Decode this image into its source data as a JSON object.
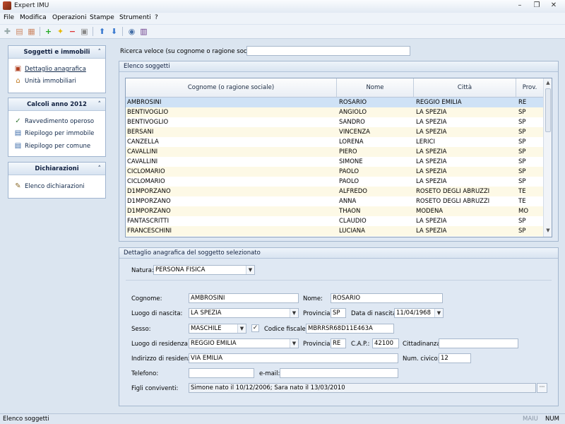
{
  "window": {
    "title": "Expert IMU"
  },
  "menu": [
    "File",
    "Modifica",
    "Operazioni",
    "Stampe",
    "Strumenti",
    "?"
  ],
  "sidebar": {
    "sections": [
      {
        "title": "Soggetti e immobili",
        "items": [
          {
            "label": "Dettaglio anagrafica",
            "icon": "person-card-icon"
          },
          {
            "label": "Unità immobiliari",
            "icon": "house-icon"
          }
        ]
      },
      {
        "title": "Calcoli anno 2012",
        "items": [
          {
            "label": "Ravvedimento operoso",
            "icon": "check-circle-icon"
          },
          {
            "label": "Riepilogo per immobile",
            "icon": "table-icon"
          },
          {
            "label": "Riepilogo per comune",
            "icon": "table-icon"
          }
        ]
      },
      {
        "title": "Dichiarazioni",
        "items": [
          {
            "label": "Elenco dichiarazioni",
            "icon": "pen-icon"
          }
        ]
      }
    ]
  },
  "search": {
    "label": "Ricerca veloce (su cognome o ragione sociale):",
    "value": ""
  },
  "list": {
    "title": "Elenco soggetti",
    "columns": [
      "Cognome (o ragione sociale)",
      "Nome",
      "Città",
      "Prov."
    ],
    "rows": [
      [
        "AMBROSINI",
        "ROSARIO",
        "REGGIO EMILIA",
        "RE"
      ],
      [
        "BENTIVOGLIO",
        "ANGIOLO",
        "LA SPEZIA",
        "SP"
      ],
      [
        "BENTIVOGLIO",
        "SANDRO",
        "LA SPEZIA",
        "SP"
      ],
      [
        "BERSANI",
        "VINCENZA",
        "LA SPEZIA",
        "SP"
      ],
      [
        "CANZELLA",
        "LORENA",
        "LERICI",
        "SP"
      ],
      [
        "CAVALLINI",
        "PIERO",
        "LA SPEZIA",
        "SP"
      ],
      [
        "CAVALLINI",
        "SIMONE",
        "LA SPEZIA",
        "SP"
      ],
      [
        "CICLOMARIO",
        "PAOLO",
        "LA SPEZIA",
        "SP"
      ],
      [
        "CICLOMARIO",
        "PAOLO",
        "LA SPEZIA",
        "SP"
      ],
      [
        "D1MPORZANO",
        "ALFREDO",
        "ROSETO DEGLI ABRUZZI",
        "TE"
      ],
      [
        "D1MPORZANO",
        "ANNA",
        "ROSETO DEGLI ABRUZZI",
        "TE"
      ],
      [
        "D1MPORZANO",
        "THAON",
        "MODENA",
        "MO"
      ],
      [
        "FANTASCRITTI",
        "CLAUDIO",
        "LA SPEZIA",
        "SP"
      ],
      [
        "FRANCESCHINI",
        "LUCIANA",
        "LA SPEZIA",
        "SP"
      ]
    ]
  },
  "detail": {
    "title": "Dettaglio anagrafica del soggetto selezionato",
    "natura_label": "Natura:",
    "natura": "PERSONA FISICA",
    "cognome_label": "Cognome:",
    "cognome": "AMBROSINI",
    "nome_label": "Nome:",
    "nome": "ROSARIO",
    "luogo_nascita_label": "Luogo di nascita:",
    "luogo_nascita": "LA SPEZIA",
    "provincia_label": "Provincia:",
    "provincia_nascita": "SP",
    "data_nascita_label": "Data di nascita:",
    "data_nascita": "11/04/1968",
    "sesso_label": "Sesso:",
    "sesso": "MASCHILE",
    "codice_fiscale_label": "Codice fiscale:",
    "codice_fiscale": "MBRRSR68D11E463A",
    "luogo_residenza_label": "Luogo di residenza:",
    "luogo_residenza": "REGGIO EMILIA",
    "provincia_residenza": "RE",
    "cap_label": "C.A.P.:",
    "cap": "42100",
    "cittadinanza_label": "Cittadinanza:",
    "cittadinanza": "",
    "indirizzo_label": "Indirizzo di residenza:",
    "indirizzo": "VIA EMILIA",
    "civico_label": "Num. civico:",
    "civico": "12",
    "telefono_label": "Telefono:",
    "telefono": "",
    "email_label": "e-mail:",
    "email": "",
    "figli_label": "Figli conviventi:",
    "figli": "Simone nato il 10/12/2006; Sara nato il 13/03/2010"
  },
  "status": {
    "text": "Elenco soggetti",
    "maiu": "MAIU",
    "num": "NUM"
  }
}
